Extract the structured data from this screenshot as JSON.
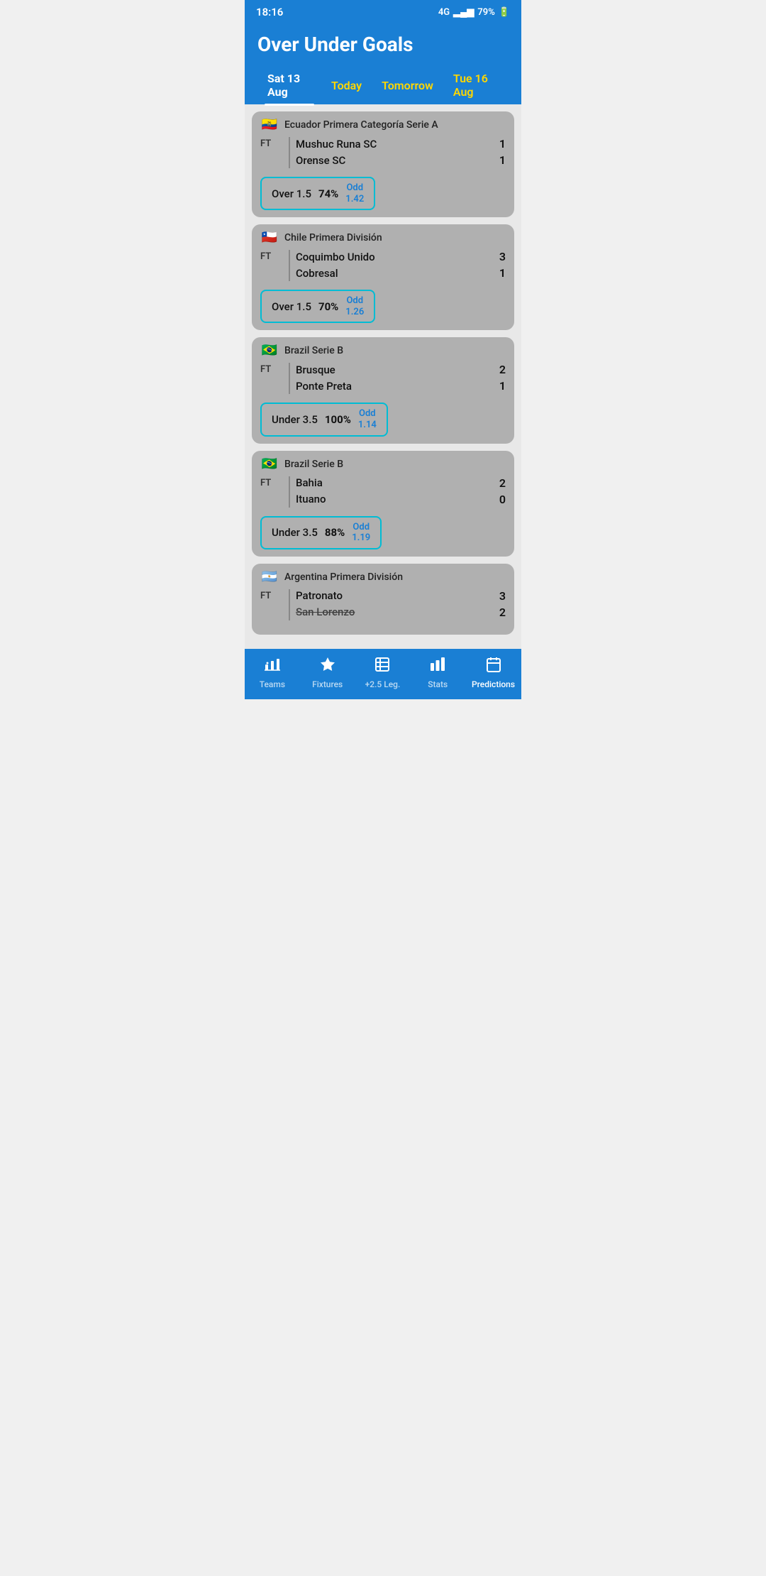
{
  "statusBar": {
    "time": "18:16",
    "signal": "4G",
    "battery": "79%"
  },
  "header": {
    "title": "Over Under Goals"
  },
  "dateTabs": [
    {
      "id": "sat13",
      "label": "Sat 13 Aug",
      "style": "active"
    },
    {
      "id": "today",
      "label": "Today",
      "style": "highlight"
    },
    {
      "id": "tomorrow",
      "label": "Tomorrow",
      "style": "highlight"
    },
    {
      "id": "tue16",
      "label": "Tue 16 Aug",
      "style": "highlight"
    }
  ],
  "matches": [
    {
      "id": 1,
      "flag": "🇪🇨",
      "league": "Ecuador Primera Categoría Serie A",
      "status": "FT",
      "team1": "Mushuc Runa SC",
      "score1": "1",
      "team2": "Orense SC",
      "score2": "1",
      "predType": "Over 1.5",
      "predPct": "74%",
      "oddLabel": "Odd",
      "oddValue": "1.42"
    },
    {
      "id": 2,
      "flag": "🇨🇱",
      "league": "Chile Primera División",
      "status": "FT",
      "team1": "Coquimbo Unido",
      "score1": "3",
      "team2": "Cobresal",
      "score2": "1",
      "predType": "Over 1.5",
      "predPct": "70%",
      "oddLabel": "Odd",
      "oddValue": "1.26"
    },
    {
      "id": 3,
      "flag": "🇧🇷",
      "league": "Brazil Serie B",
      "status": "FT",
      "team1": "Brusque",
      "score1": "2",
      "team2": "Ponte Preta",
      "score2": "1",
      "predType": "Under 3.5",
      "predPct": "100%",
      "oddLabel": "Odd",
      "oddValue": "1.14"
    },
    {
      "id": 4,
      "flag": "🇧🇷",
      "league": "Brazil Serie B",
      "status": "FT",
      "team1": "Bahia",
      "score1": "2",
      "team2": "Ituano",
      "score2": "0",
      "predType": "Under 3.5",
      "predPct": "88%",
      "oddLabel": "Odd",
      "oddValue": "1.19"
    },
    {
      "id": 5,
      "flag": "🇦🇷",
      "league": "Argentina Primera División",
      "status": "FT",
      "team1": "Patronato",
      "score1": "3",
      "team2": "San Lorenzo",
      "score2": "2",
      "predType": "",
      "predPct": "",
      "oddLabel": "",
      "oddValue": ""
    }
  ],
  "bottomNav": [
    {
      "id": "teams",
      "icon": "📊",
      "label": "Teams",
      "active": false
    },
    {
      "id": "fixtures",
      "icon": "⭐",
      "label": "Fixtures",
      "active": false
    },
    {
      "id": "leg25",
      "icon": "📋",
      "label": "+2.5 Leg.",
      "active": false
    },
    {
      "id": "stats",
      "icon": "📈",
      "label": "Stats",
      "active": false
    },
    {
      "id": "predictions",
      "icon": "📅",
      "label": "Predictions",
      "active": true
    }
  ]
}
